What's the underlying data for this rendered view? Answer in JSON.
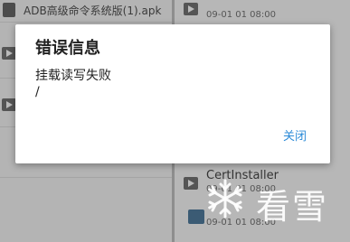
{
  "background": {
    "left_top_file": "ADB高级命令系统版(1).apk",
    "right_date_1": "09-01 01 08:00",
    "right_title_2": "CertInstaller",
    "right_date_2": "09-01 01 08:00",
    "right_date_3": "09-01 01 08:00"
  },
  "dialog": {
    "title": "错误信息",
    "message": "挂载读写失败\n/",
    "close_label": "关闭",
    "accent_color": "#2c8bd8"
  },
  "watermark": {
    "text": "看雪",
    "icon": "snowflake-icon"
  }
}
